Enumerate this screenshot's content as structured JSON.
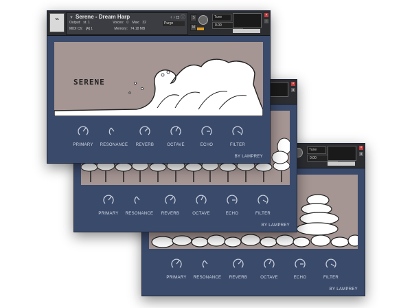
{
  "instrument": {
    "title": "Serene - Dream Harp",
    "output_label": "Output:",
    "output_value": "st. 1",
    "midi_label": "MIDI Ch:",
    "midi_value": "[A] 1",
    "voices_label": "Voices:",
    "voices_value": "0",
    "max_label": "Max:",
    "max_value": "32",
    "purge_label": "Purge",
    "memory_label": "Memory:",
    "memory_value": "74.18 MB",
    "tune_label": "Tune",
    "tune_value": "0.00"
  },
  "art_text": "SERENE",
  "knob_labels": [
    "PRIMARY",
    "RESONANCE",
    "REVERB",
    "OCTAVE",
    "ECHO",
    "FILTER"
  ],
  "knob_icons": [
    "knob-icon",
    "knob-icon",
    "knob-icon",
    "knob-icon",
    "knob-icon",
    "knob-icon"
  ],
  "footer": "BY LAMPREY",
  "colors": {
    "panel": "#3a4a6b",
    "art_bg": "#a59593",
    "header": "#2b2d31"
  }
}
